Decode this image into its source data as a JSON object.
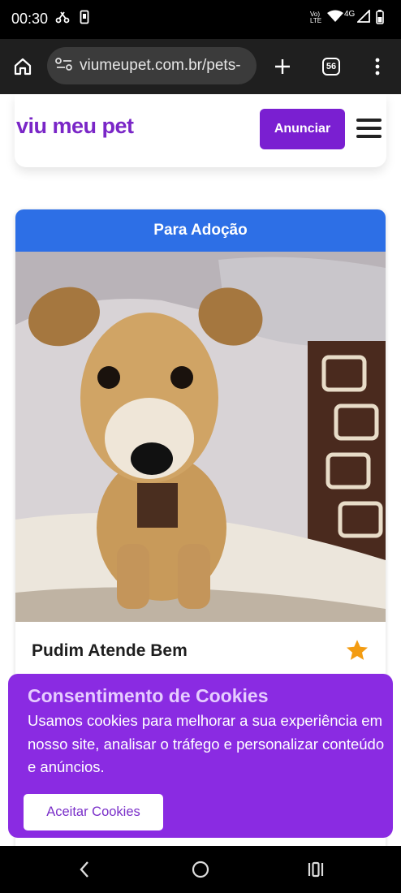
{
  "status_bar": {
    "time": "00:30",
    "network_label": "Vo) LTE",
    "network_type": "4G",
    "icons": [
      "link-icon",
      "phone-icon",
      "wifi-icon",
      "signal-icon",
      "battery-icon"
    ]
  },
  "browser": {
    "url": "viumeupet.com.br/pets-",
    "tab_count": "56",
    "icons": [
      "home-icon",
      "site-settings-icon",
      "new-tab-icon",
      "tabs-icon",
      "menu-icon"
    ]
  },
  "site_header": {
    "logo": "viu meu pet",
    "cta_label": "Anunciar",
    "menu_icon": "hamburger-icon"
  },
  "listing": {
    "badge": "Para Adoção",
    "title": "Pudim Atende Bem",
    "favorite_icon": "star-icon",
    "star_color": "#f39c12"
  },
  "cookie_banner": {
    "title": "Consentimento de Cookies",
    "text": "Usamos cookies para melhorar a sua experiência em nosso site, analisar o tráfego e personalizar conteúdo e anúncios.",
    "accept_label": "Aceitar Cookies"
  },
  "colors": {
    "brand_purple": "#7a1fd1",
    "badge_blue": "#2d6fe6",
    "cookie_purple": "#8a2be2"
  },
  "nav_bar": {
    "icons": [
      "back-icon",
      "home-circle-icon",
      "recents-icon"
    ]
  }
}
